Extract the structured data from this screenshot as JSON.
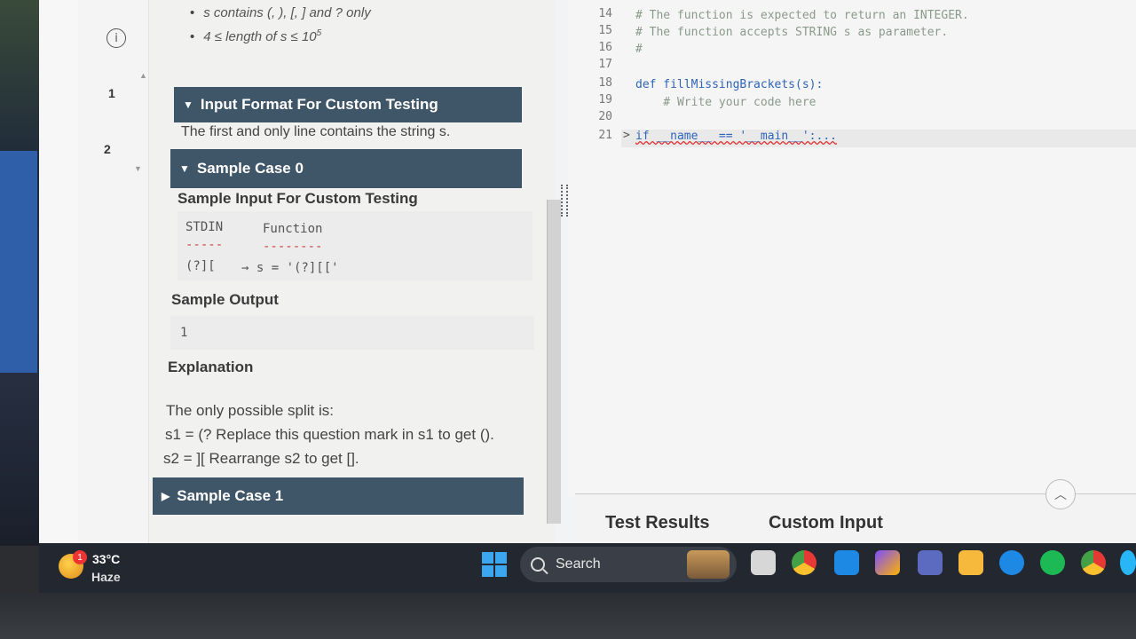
{
  "problem": {
    "constraints": [
      "s contains (, ), [, ] and ? only",
      "4 ≤ length of s ≤ 10",
      "5"
    ],
    "question_numbers": [
      "1",
      "2"
    ],
    "input_format_title": "Input Format For Custom Testing",
    "input_format_text": "The first and only line contains the string s.",
    "sample_case_0_title": "Sample Case 0",
    "sample_input_heading": "Sample Input For Custom Testing",
    "stdin_header": "STDIN",
    "function_header": "Function",
    "stdin_dashes": "-----",
    "function_dashes": "--------",
    "stdin_value": "(?][",
    "function_value": "→ s = '(?][['",
    "sample_output_heading": "Sample Output",
    "sample_output_value": "1",
    "explanation_heading": "Explanation",
    "explanation_lines": [
      "The only possible split is:",
      "s1 = (? Replace this question mark in s1 to get ().",
      "s2 = ][ Rearrange s2 to get []."
    ],
    "sample_case_1_title": "Sample Case 1"
  },
  "editor": {
    "lines": [
      {
        "n": "14",
        "code": "# The function is expected to return an INTEGER."
      },
      {
        "n": "15",
        "code": "# The function accepts STRING s as parameter."
      },
      {
        "n": "16",
        "code": "#"
      },
      {
        "n": "17",
        "code": ""
      },
      {
        "n": "18",
        "code": "def fillMissingBrackets(s):"
      },
      {
        "n": "19",
        "code": "    # Write your code here"
      },
      {
        "n": "20",
        "code": ""
      },
      {
        "n": "21",
        "code": "if __name__ == '__main__':..."
      }
    ],
    "fold_marker": ">"
  },
  "bottom_tabs": {
    "test_results": "Test Results",
    "custom_input": "Custom Input"
  },
  "taskbar": {
    "temperature": "33°C",
    "condition": "Haze",
    "weather_badge": "1",
    "search_label": "Search"
  },
  "colors": {
    "section_bar": "#3f5568",
    "keyword": "#2f64b7",
    "comment": "#8a9a8a"
  }
}
